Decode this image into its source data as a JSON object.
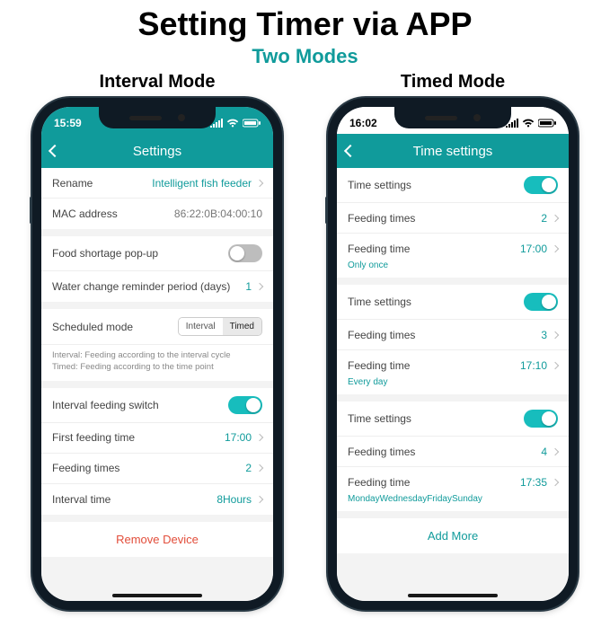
{
  "heading": "Setting Timer via APP",
  "subheading": "Two Modes",
  "colors": {
    "accent": "#109b9b",
    "danger": "#e24d3a"
  },
  "interval": {
    "mode_label": "Interval Mode",
    "status_time": "15:59",
    "header_title": "Settings",
    "rows": {
      "rename_label": "Rename",
      "rename_value": "Intelligent fish feeder",
      "mac_label": "MAC address",
      "mac_value": "86:22:0B:04:00:10",
      "shortage_label": "Food shortage pop-up",
      "shortage_on": false,
      "water_label": "Water change reminder period (days)",
      "water_value": "1",
      "sched_label": "Scheduled mode",
      "seg_interval": "Interval",
      "seg_timed": "Timed",
      "help_line1": "Interval: Feeding according to the interval cycle",
      "help_line2": "Timed: Feeding according to the time point",
      "switch_label": "Interval feeding switch",
      "switch_on": true,
      "first_label": "First feeding time",
      "first_value": "17:00",
      "times_label": "Feeding times",
      "times_value": "2",
      "interval_label": "Interval time",
      "interval_value": "8Hours",
      "remove": "Remove Device"
    }
  },
  "timed": {
    "mode_label": "Timed Mode",
    "status_time": "16:02",
    "header_title": "Time settings",
    "blocks": [
      {
        "settings_on": true,
        "times": "2",
        "time": "17:00",
        "repeat": "Only once"
      },
      {
        "settings_on": true,
        "times": "3",
        "time": "17:10",
        "repeat": "Every day"
      },
      {
        "settings_on": true,
        "times": "4",
        "time": "17:35",
        "repeat": "MondayWednesdayFridaySunday"
      }
    ],
    "labels": {
      "time_settings": "Time settings",
      "feeding_times": "Feeding times",
      "feeding_time": "Feeding time",
      "add_more": "Add More"
    }
  }
}
